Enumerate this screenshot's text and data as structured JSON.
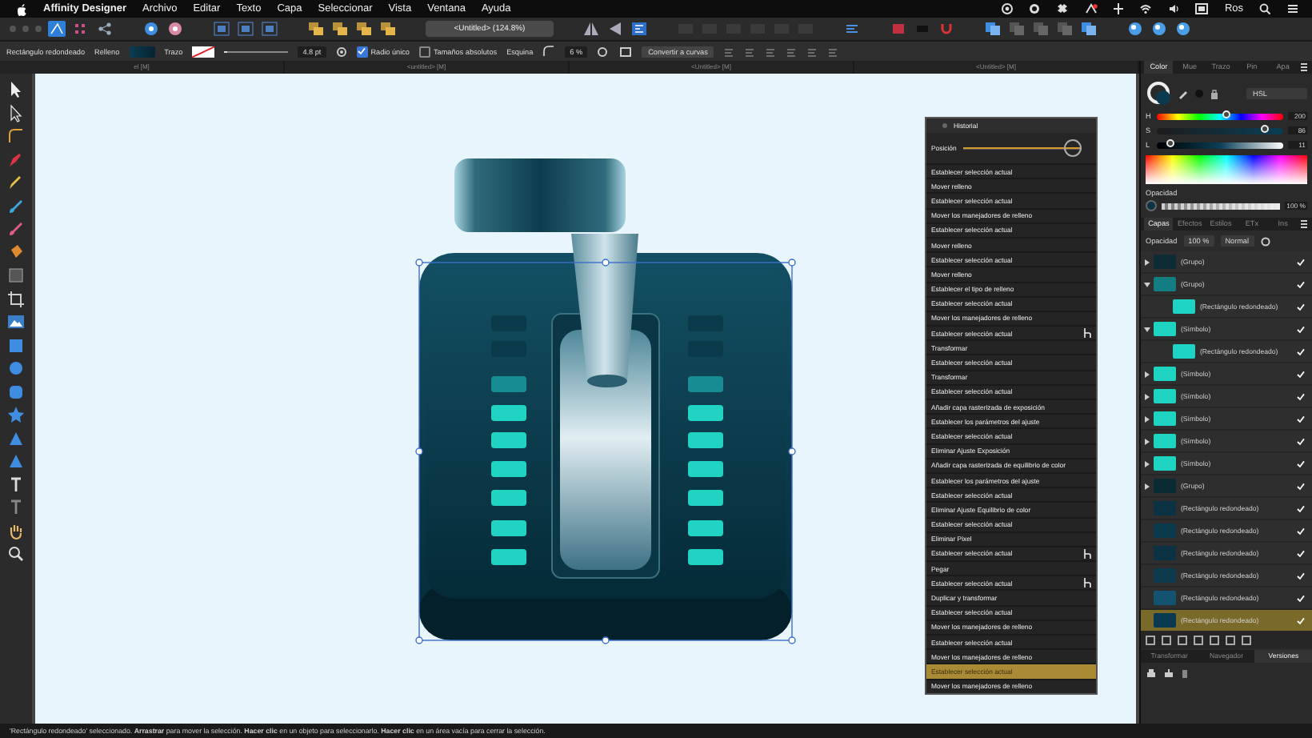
{
  "menubar": {
    "app_name": "Affinity Designer",
    "menus": [
      "Archivo",
      "Editar",
      "Texto",
      "Capa",
      "Seleccionar",
      "Vista",
      "Ventana",
      "Ayuda"
    ],
    "user": "Ros"
  },
  "toolbar": {
    "document": "<Untitled> (124.8%)"
  },
  "context_bar": {
    "shape": "Rectángulo redondeado",
    "fill_label": "Relleno",
    "stroke_label": "Trazo",
    "stroke_width": {
      "level": 0.05,
      "reading": "4.8 pt"
    },
    "options": [
      {
        "label": "Radio único",
        "checked": true
      },
      {
        "label": "Tamaños absolutos",
        "checked": false
      }
    ],
    "corner_label": "Esquina",
    "corner_value": "6 %",
    "convert_button": "Convertir a curvas"
  },
  "document_tabs": [
    "el [M]",
    "<untitled> [M]",
    "<Untitled> [M]",
    "<Untitled> [M]"
  ],
  "history": {
    "title": "Historial",
    "position_label": "Posición",
    "position": {
      "level": 1
    },
    "entries": [
      {
        "label": "Establecer selección actual",
        "marker": false,
        "selected": false
      },
      {
        "label": "Mover relleno",
        "marker": false,
        "selected": false
      },
      {
        "label": "Establecer selección actual",
        "marker": false,
        "selected": false
      },
      {
        "label": "Mover los manejadores de relleno",
        "marker": false,
        "selected": false
      },
      {
        "label": "Establecer selección actual",
        "marker": false,
        "selected": false
      },
      {
        "label": "Mover relleno",
        "marker": false,
        "selected": false
      },
      {
        "label": "Establecer selección actual",
        "marker": false,
        "selected": false
      },
      {
        "label": "Mover relleno",
        "marker": false,
        "selected": false
      },
      {
        "label": "Establecer el tipo de relleno",
        "marker": false,
        "selected": false
      },
      {
        "label": "Establecer selección actual",
        "marker": false,
        "selected": false
      },
      {
        "label": "Mover los manejadores de relleno",
        "marker": false,
        "selected": false
      },
      {
        "label": "Establecer selección actual",
        "marker": true,
        "selected": false
      },
      {
        "label": "Transformar",
        "marker": false,
        "selected": false
      },
      {
        "label": "Establecer selección actual",
        "marker": false,
        "selected": false
      },
      {
        "label": "Transformar",
        "marker": false,
        "selected": false
      },
      {
        "label": "Establecer selección actual",
        "marker": false,
        "selected": false
      },
      {
        "label": "Añadir capa rasterizada de exposición",
        "marker": false,
        "selected": false
      },
      {
        "label": "Establecer los parámetros del ajuste",
        "marker": false,
        "selected": false
      },
      {
        "label": "Establecer selección actual",
        "marker": false,
        "selected": false
      },
      {
        "label": "Eliminar Ajuste Exposición",
        "marker": false,
        "selected": false
      },
      {
        "label": "Añadir capa rasterizada de equilibrio de color",
        "marker": false,
        "selected": false
      },
      {
        "label": "Establecer los parámetros del ajuste",
        "marker": false,
        "selected": false
      },
      {
        "label": "Establecer selección actual",
        "marker": false,
        "selected": false
      },
      {
        "label": "Eliminar Ajuste Equilibrio de color",
        "marker": false,
        "selected": false
      },
      {
        "label": "Establecer selección actual",
        "marker": false,
        "selected": false
      },
      {
        "label": "Eliminar Pixel",
        "marker": false,
        "selected": false
      },
      {
        "label": "Establecer selección actual",
        "marker": true,
        "selected": false
      },
      {
        "label": "Pegar",
        "marker": false,
        "selected": false
      },
      {
        "label": "Establecer selección actual",
        "marker": true,
        "selected": false
      },
      {
        "label": "Duplicar y transformar",
        "marker": false,
        "selected": false
      },
      {
        "label": "Establecer selección actual",
        "marker": false,
        "selected": false
      },
      {
        "label": "Mover los manejadores de relleno",
        "marker": false,
        "selected": false
      },
      {
        "label": "Establecer selección actual",
        "marker": false,
        "selected": false
      },
      {
        "label": "Mover los manejadores de relleno",
        "marker": false,
        "selected": false
      },
      {
        "label": "Establecer selección actual",
        "marker": false,
        "selected": true
      },
      {
        "label": "Mover los manejadores de relleno",
        "marker": false,
        "selected": false
      }
    ]
  },
  "color_panel": {
    "tabs": [
      {
        "label": "Color",
        "selected": true
      },
      {
        "label": "Mue",
        "selected": false
      },
      {
        "label": "Trazo",
        "selected": false
      },
      {
        "label": "Pin",
        "selected": false
      },
      {
        "label": "Apa",
        "selected": false
      }
    ],
    "model": "HSL",
    "sliders": [
      {
        "label": "H",
        "kind": "hue",
        "level": 0.556,
        "reading": "200"
      },
      {
        "label": "S",
        "kind": "saturation",
        "level": 0.86,
        "reading": "86"
      },
      {
        "label": "L",
        "kind": "lightness",
        "level": 0.11,
        "reading": "11"
      }
    ],
    "opacity_label": "Opacidad",
    "opacity": {
      "level": 1,
      "reading": "100 %"
    }
  },
  "layers": {
    "tabs": [
      {
        "label": "Capas",
        "selected": true
      },
      {
        "label": "Efectos",
        "selected": false
      },
      {
        "label": "Estilos",
        "selected": false
      },
      {
        "label": "ETx",
        "selected": false
      },
      {
        "label": "Ins",
        "selected": false
      }
    ],
    "opacity_label": "Opacidad",
    "opacity": "100 %",
    "blend_mode": "Normal",
    "items": [
      {
        "name": "(Grupo)",
        "kind": "group",
        "expanded": false,
        "visible": true,
        "selected": false,
        "color": "#0e2c36"
      },
      {
        "name": "(Grupo)",
        "kind": "group",
        "expanded": true,
        "visible": true,
        "selected": false,
        "color": "#137e82",
        "children": [
          {
            "name": "(Rectángulo redondeado)",
            "kind": "shape",
            "visible": true,
            "selected": false,
            "color": "#1ed3c2"
          }
        ]
      },
      {
        "name": "(Símbolo)",
        "kind": "group",
        "expanded": true,
        "visible": true,
        "selected": false,
        "color": "#1ed3c2",
        "children": [
          {
            "name": "(Rectángulo redondeado)",
            "kind": "shape",
            "visible": true,
            "selected": false,
            "color": "#1ed3c2"
          }
        ]
      },
      {
        "name": "(Símbolo)",
        "kind": "group",
        "expanded": false,
        "visible": true,
        "selected": false,
        "color": "#1ed3c2"
      },
      {
        "name": "(Símbolo)",
        "kind": "group",
        "expanded": false,
        "visible": true,
        "selected": false,
        "color": "#1ed3c2"
      },
      {
        "name": "(Símbolo)",
        "kind": "group",
        "expanded": false,
        "visible": true,
        "selected": false,
        "color": "#1ed3c2"
      },
      {
        "name": "(Símbolo)",
        "kind": "group",
        "expanded": false,
        "visible": true,
        "selected": false,
        "color": "#1ed3c2"
      },
      {
        "name": "(Símbolo)",
        "kind": "group",
        "expanded": false,
        "visible": true,
        "selected": false,
        "color": "#1ed3c2"
      },
      {
        "name": "(Grupo)",
        "kind": "group",
        "expanded": false,
        "visible": true,
        "selected": false,
        "color": "#0a2a34"
      },
      {
        "name": "(Rectángulo redondeado)",
        "kind": "shape",
        "visible": true,
        "selected": false,
        "color": "#0b3344"
      },
      {
        "name": "(Rectángulo redondeado)",
        "kind": "shape",
        "visible": true,
        "selected": false,
        "color": "#0a3a4c"
      },
      {
        "name": "(Rectángulo redondeado)",
        "kind": "shape",
        "visible": true,
        "selected": false,
        "color": "#0b3344"
      },
      {
        "name": "(Rectángulo redondeado)",
        "kind": "shape",
        "visible": true,
        "selected": false,
        "color": "#0d3a4c"
      },
      {
        "name": "(Rectángulo redondeado)",
        "kind": "shape",
        "visible": true,
        "selected": false,
        "color": "#145370"
      },
      {
        "name": "(Rectángulo redondeado)",
        "kind": "shape",
        "visible": true,
        "selected": true,
        "color": "#0b3a50"
      }
    ]
  },
  "bottom_tabs": [
    {
      "label": "Transformar",
      "selected": false
    },
    {
      "label": "Navegador",
      "selected": false
    },
    {
      "label": "Versiones",
      "selected": true
    }
  ],
  "status_bar": "'Rectángulo redondeado' seleccionado. **Arrastrar** para mover la selección. **Hacer clic** en un objeto para seleccionarlo. **Hacer clic** en un área vacía para cerrar la selección."
}
